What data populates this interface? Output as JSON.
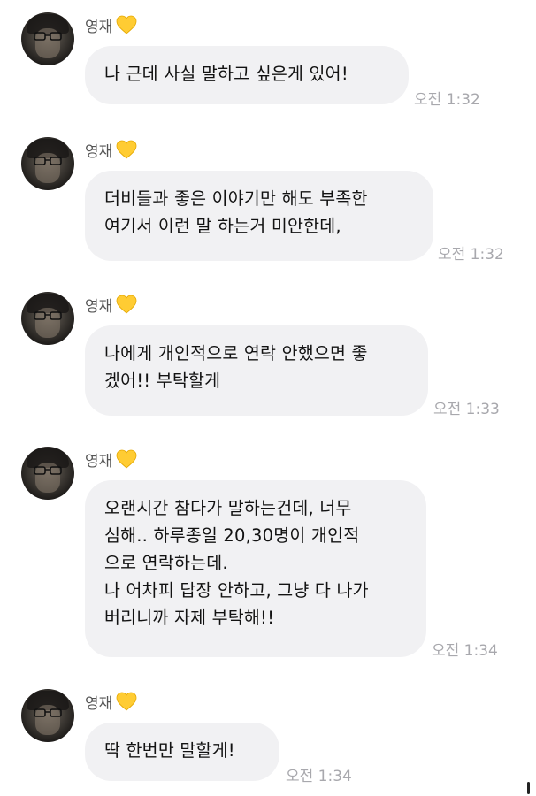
{
  "sender": {
    "name": "영재",
    "name_icon": "yellow-heart-icon",
    "heart_color": "#FFCC33"
  },
  "messages": [
    {
      "text": "나 근데 사실 말하고 싶은게 있어!",
      "time": "오전 1:32"
    },
    {
      "text": "더비들과 좋은 이야기만 해도 부족한\n여기서 이런 말 하는거 미안한데,",
      "time": "오전 1:32"
    },
    {
      "text": "나에게 개인적으로 연락 안했으면 좋\n겠어!! 부탁할게",
      "time": "오전 1:33"
    },
    {
      "text": "오랜시간 참다가 말하는건데, 너무\n심해.. 하루종일 20,30명이 개인적\n으로 연락하는데.\n나 어차피 답장 안하고, 그냥 다 나가\n버리니까 자제 부탁해!!",
      "time": "오전 1:34"
    },
    {
      "text": "딱 한번만 말할게!",
      "time": "오전 1:34"
    }
  ],
  "colors": {
    "bubble_bg": "#F1F1F3",
    "timestamp": "#A8A8AD",
    "name": "#555555"
  }
}
